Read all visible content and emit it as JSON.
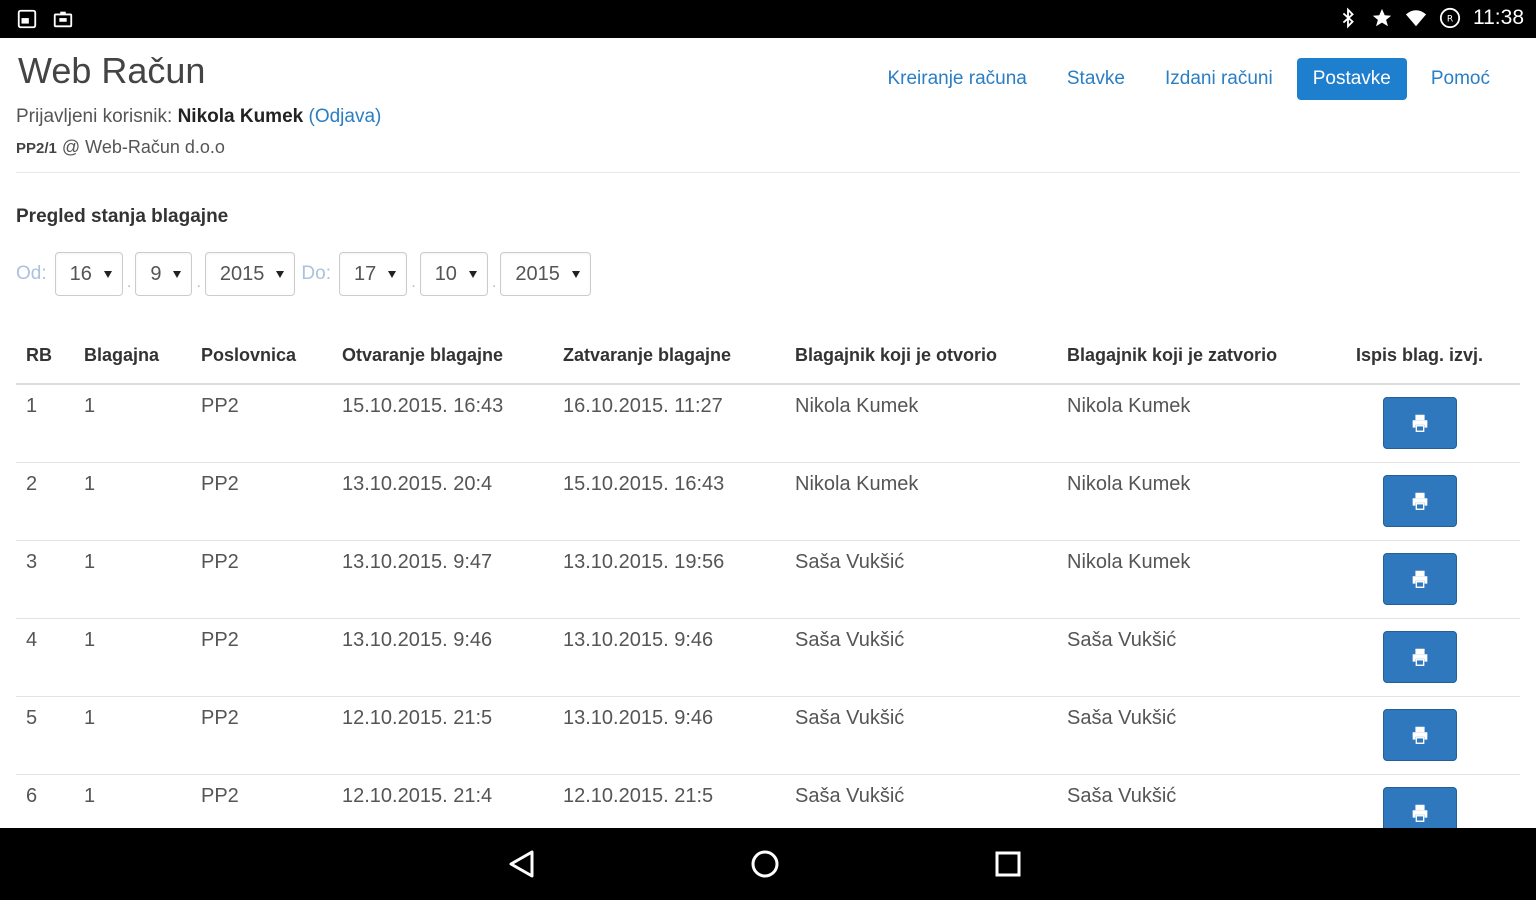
{
  "status_bar": {
    "time": "11:38",
    "left_icons": [
      "screenshot-icon",
      "briefcase-icon"
    ],
    "right_icons": [
      "bluetooth-icon",
      "star-icon",
      "wifi-icon",
      "battery-icon"
    ]
  },
  "header": {
    "app_title": "Web Račun",
    "user_prefix": "Prijavljeni korisnik:",
    "user_name": "Nikola Kumek",
    "logout_label": "(Odjava)",
    "company_code": "PP2/1",
    "company_rest": " @ Web-Račun d.o.o"
  },
  "nav": {
    "items": [
      {
        "label": "Kreiranje računa"
      },
      {
        "label": "Stavke"
      },
      {
        "label": "Izdani računi"
      },
      {
        "label": "Postavke",
        "active": true
      },
      {
        "label": "Pomoć"
      }
    ],
    "accent_color": "#1f7fcf"
  },
  "section": {
    "title": "Pregled stanja blagajne"
  },
  "filters": {
    "from_label": "Od:",
    "to_label": "Do:",
    "from_day": "16",
    "from_month": "9",
    "from_year": "2015",
    "to_day": "17",
    "to_month": "10",
    "to_year": "2015",
    "separator": "."
  },
  "table": {
    "columns": [
      "RB",
      "Blagajna",
      "Poslovnica",
      "Otvaranje blagajne",
      "Zatvaranje blagajne",
      "Blagajnik koji je otvorio",
      "Blagajnik koji je zatvorio",
      "Ispis blag. izvj."
    ],
    "rows": [
      {
        "rb": "1",
        "blagajna": "1",
        "poslovnica": "PP2",
        "otvaranje": "15.10.2015. 16:43",
        "zatvaranje": "16.10.2015. 11:27",
        "otvorio": "Nikola Kumek",
        "zatvorio": "Nikola Kumek"
      },
      {
        "rb": "2",
        "blagajna": "1",
        "poslovnica": "PP2",
        "otvaranje": "13.10.2015. 20:4",
        "zatvaranje": "15.10.2015. 16:43",
        "otvorio": "Nikola Kumek",
        "zatvorio": "Nikola Kumek"
      },
      {
        "rb": "3",
        "blagajna": "1",
        "poslovnica": "PP2",
        "otvaranje": "13.10.2015. 9:47",
        "zatvaranje": "13.10.2015. 19:56",
        "otvorio": "Saša Vukšić",
        "zatvorio": "Nikola Kumek"
      },
      {
        "rb": "4",
        "blagajna": "1",
        "poslovnica": "PP2",
        "otvaranje": "13.10.2015. 9:46",
        "zatvaranje": "13.10.2015. 9:46",
        "otvorio": "Saša Vukšić",
        "zatvorio": "Saša Vukšić"
      },
      {
        "rb": "5",
        "blagajna": "1",
        "poslovnica": "PP2",
        "otvaranje": "12.10.2015. 21:5",
        "zatvaranje": "13.10.2015. 9:46",
        "otvorio": "Saša Vukšić",
        "zatvorio": "Saša Vukšić"
      },
      {
        "rb": "6",
        "blagajna": "1",
        "poslovnica": "PP2",
        "otvaranje": "12.10.2015. 21:4",
        "zatvaranje": "12.10.2015. 21:5",
        "otvorio": "Saša Vukšić",
        "zatvorio": "Saša Vukšić"
      }
    ],
    "print_icon": "print-icon",
    "button_color": "#2f78bd"
  },
  "android_nav": {
    "icons": [
      "back-icon",
      "home-icon",
      "recents-icon"
    ]
  }
}
